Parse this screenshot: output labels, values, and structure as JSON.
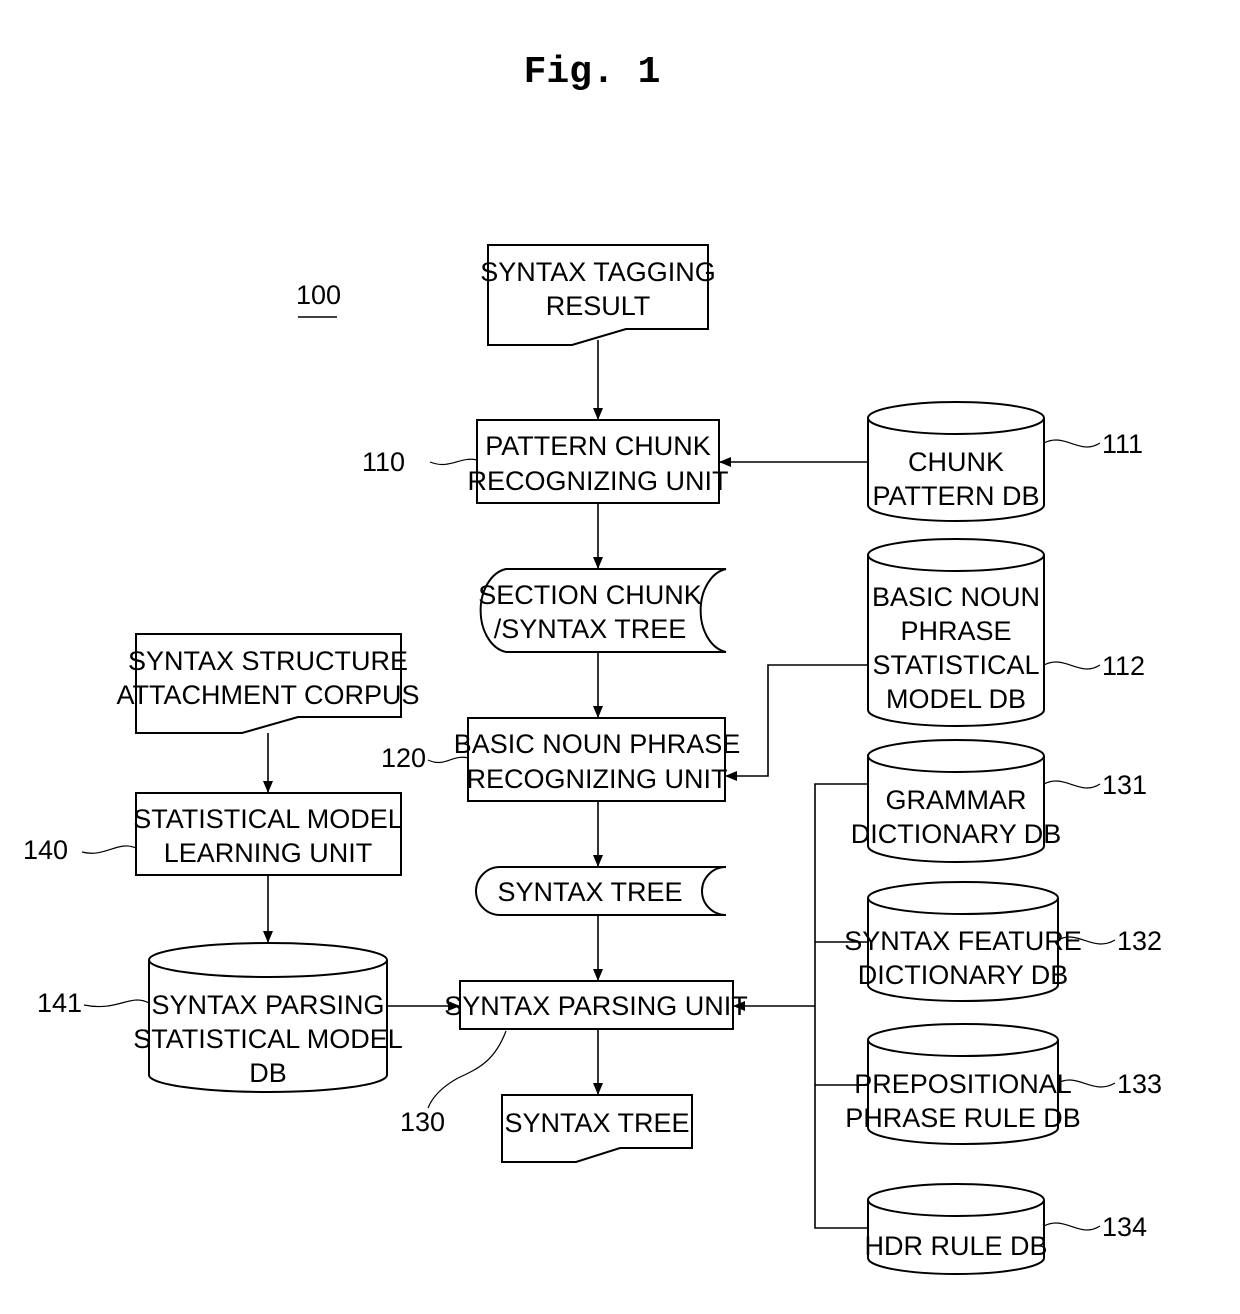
{
  "figure": {
    "title": "Fig. 1",
    "system_ref": "100"
  },
  "nodes": {
    "syntax_tagging_result": {
      "lines": [
        "SYNTAX TAGGING",
        "RESULT"
      ],
      "ref": ""
    },
    "pattern_chunk_unit": {
      "lines": [
        "PATTERN CHUNK",
        "RECOGNIZING UNIT"
      ],
      "ref": "110"
    },
    "chunk_pattern_db": {
      "lines": [
        "CHUNK",
        "PATTERN DB"
      ],
      "ref": "111"
    },
    "section_chunk_tree": {
      "lines": [
        "SECTION CHUNK",
        "/SYNTAX TREE"
      ],
      "ref": ""
    },
    "basic_np_stat_db": {
      "lines": [
        "BASIC NOUN",
        "PHRASE",
        "STATISTICAL",
        "MODEL DB"
      ],
      "ref": "112"
    },
    "basic_np_unit": {
      "lines": [
        "BASIC NOUN PHRASE",
        "RECOGNIZING UNIT"
      ],
      "ref": "120"
    },
    "syntax_tree_mid": {
      "lines": [
        "SYNTAX TREE"
      ],
      "ref": ""
    },
    "syntax_parsing_unit": {
      "lines": [
        "SYNTAX PARSING UNIT"
      ],
      "ref": "130"
    },
    "syntax_tree_out": {
      "lines": [
        "SYNTAX TREE"
      ],
      "ref": ""
    },
    "grammar_dict_db": {
      "lines": [
        "GRAMMAR",
        "DICTIONARY DB"
      ],
      "ref": "131"
    },
    "syntax_feature_db": {
      "lines": [
        "SYNTAX FEATURE",
        "DICTIONARY DB"
      ],
      "ref": "132"
    },
    "prep_phrase_db": {
      "lines": [
        "PREPOSITIONAL",
        "PHRASE RULE DB"
      ],
      "ref": "133"
    },
    "hdr_rule_db": {
      "lines": [
        "HDR RULE DB"
      ],
      "ref": "134"
    },
    "corpus": {
      "lines": [
        "SYNTAX STRUCTURE",
        "ATTACHMENT CORPUS"
      ],
      "ref": ""
    },
    "stat_learning_unit": {
      "lines": [
        "STATISTICAL MODEL",
        "LEARNING UNIT"
      ],
      "ref": "140"
    },
    "parsing_stat_db": {
      "lines": [
        "SYNTAX PARSING",
        "STATISTICAL MODEL",
        "DB"
      ],
      "ref": "141"
    }
  }
}
